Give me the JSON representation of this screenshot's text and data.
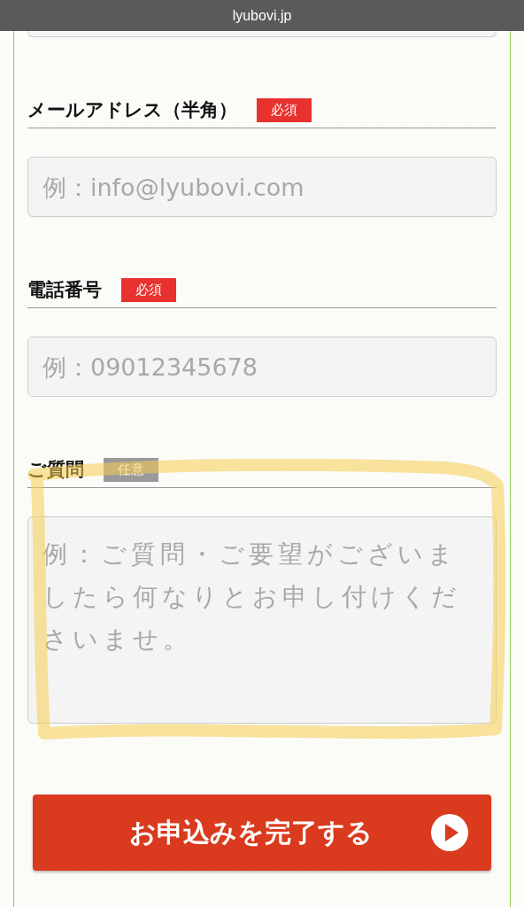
{
  "browser": {
    "url": "lyubovi.jp"
  },
  "fields": [
    {
      "label": "メールアドレス（半角）",
      "badge": {
        "text": "必須",
        "kind": "required"
      },
      "kind": "input",
      "placeholder": "例：info@lyubovi.com"
    },
    {
      "label": "電話番号",
      "badge": {
        "text": "必須",
        "kind": "required"
      },
      "kind": "input",
      "placeholder": "例：09012345678"
    },
    {
      "label": "ご質問",
      "badge": {
        "text": "任意",
        "kind": "optional"
      },
      "kind": "textarea",
      "placeholder": "例：ご質問・ご要望がございましたら何なりとお申し付けくださいませ。"
    }
  ],
  "submit": {
    "label": "お申込みを完了する"
  }
}
